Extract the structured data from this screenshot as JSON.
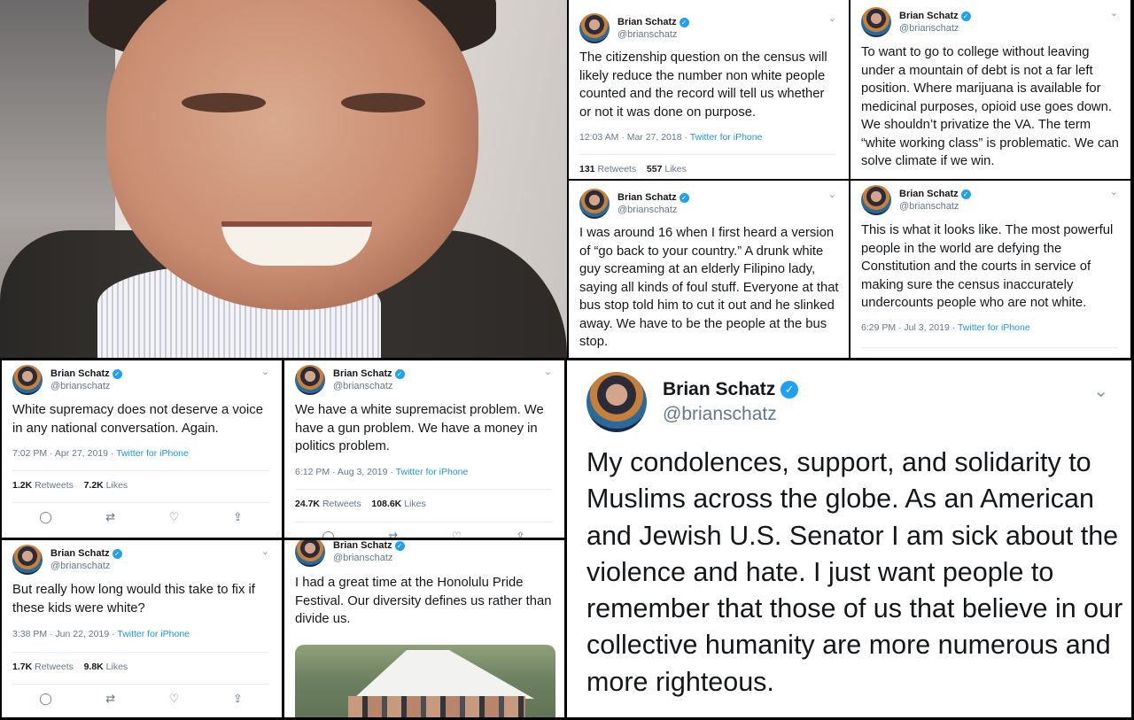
{
  "author": {
    "name": "Brian Schatz",
    "handle": "@brianschatz"
  },
  "icons": {
    "verified": "verified-badge-icon",
    "chevron": "chevron-down-icon",
    "reply": "reply-icon",
    "retweet": "retweet-icon",
    "like": "heart-icon",
    "share": "share-icon"
  },
  "colors": {
    "link": "#1b95e0",
    "verified": "#1da1f2",
    "muted": "#657786"
  },
  "tweets": [
    {
      "text": "The citizenship question on the census will likely reduce the number non white people counted and the record will tell us whether or not it was done on purpose.",
      "time": "12:03 AM · Mar 27, 2018",
      "source": "Twitter for iPhone",
      "retweets": "131",
      "likes": "557",
      "retweets_label": "Retweets",
      "likes_label": "Likes"
    },
    {
      "text": "To want to go to college without leaving under a mountain of debt is not a far left position. Where marijuana is available for medicinal purposes, opioid use goes down. We shouldn’t privatize the VA. The term “white working class” is problematic. We can solve climate if we win."
    },
    {
      "text": "I was around 16 when I first heard a version of “go back to your country.” A drunk white guy screaming at an elderly Filipino lady, saying all kinds of foul stuff. Everyone at that bus stop told him to cut it out and he slinked away. We have to be the people at the bus stop."
    },
    {
      "text": "This is what it looks like. The most powerful people in the world  are defying the Constitution and the courts in service of making sure the census inaccurately undercounts people who are not white.",
      "time": "6:29 PM · Jul 3, 2019",
      "source": "Twitter for iPhone"
    },
    {
      "text": "White supremacy does not deserve a voice in any national conversation. Again.",
      "time": "7:02 PM · Apr 27, 2019",
      "source": "Twitter for iPhone",
      "retweets": "1.2K",
      "likes": "7.2K",
      "retweets_label": "Retweets",
      "likes_label": "Likes"
    },
    {
      "text": "We have a white supremacist problem. We have a gun problem. We have a money in politics problem.",
      "time": "6:12 PM · Aug 3, 2019",
      "source": "Twitter for iPhone",
      "retweets": "24.7K",
      "likes": "108.6K",
      "retweets_label": "Retweets",
      "likes_label": "Likes"
    },
    {
      "text": "But really how long would this take to fix if these kids were white?",
      "time": "3:38 PM · Jun 22, 2019",
      "source": "Twitter for iPhone",
      "retweets": "1.7K",
      "likes": "9.8K",
      "retweets_label": "Retweets",
      "likes_label": "Likes"
    },
    {
      "text": "I had a great time at the Honolulu Pride Festival. Our diversity defines us rather than divide us."
    },
    {
      "text": "My condolences, support, and solidarity to Muslims across the globe. As an American and Jewish U.S. Senator I am sick about the violence and hate. I just want people to remember that those of us that believe in our collective humanity are more numerous and more righteous."
    }
  ]
}
